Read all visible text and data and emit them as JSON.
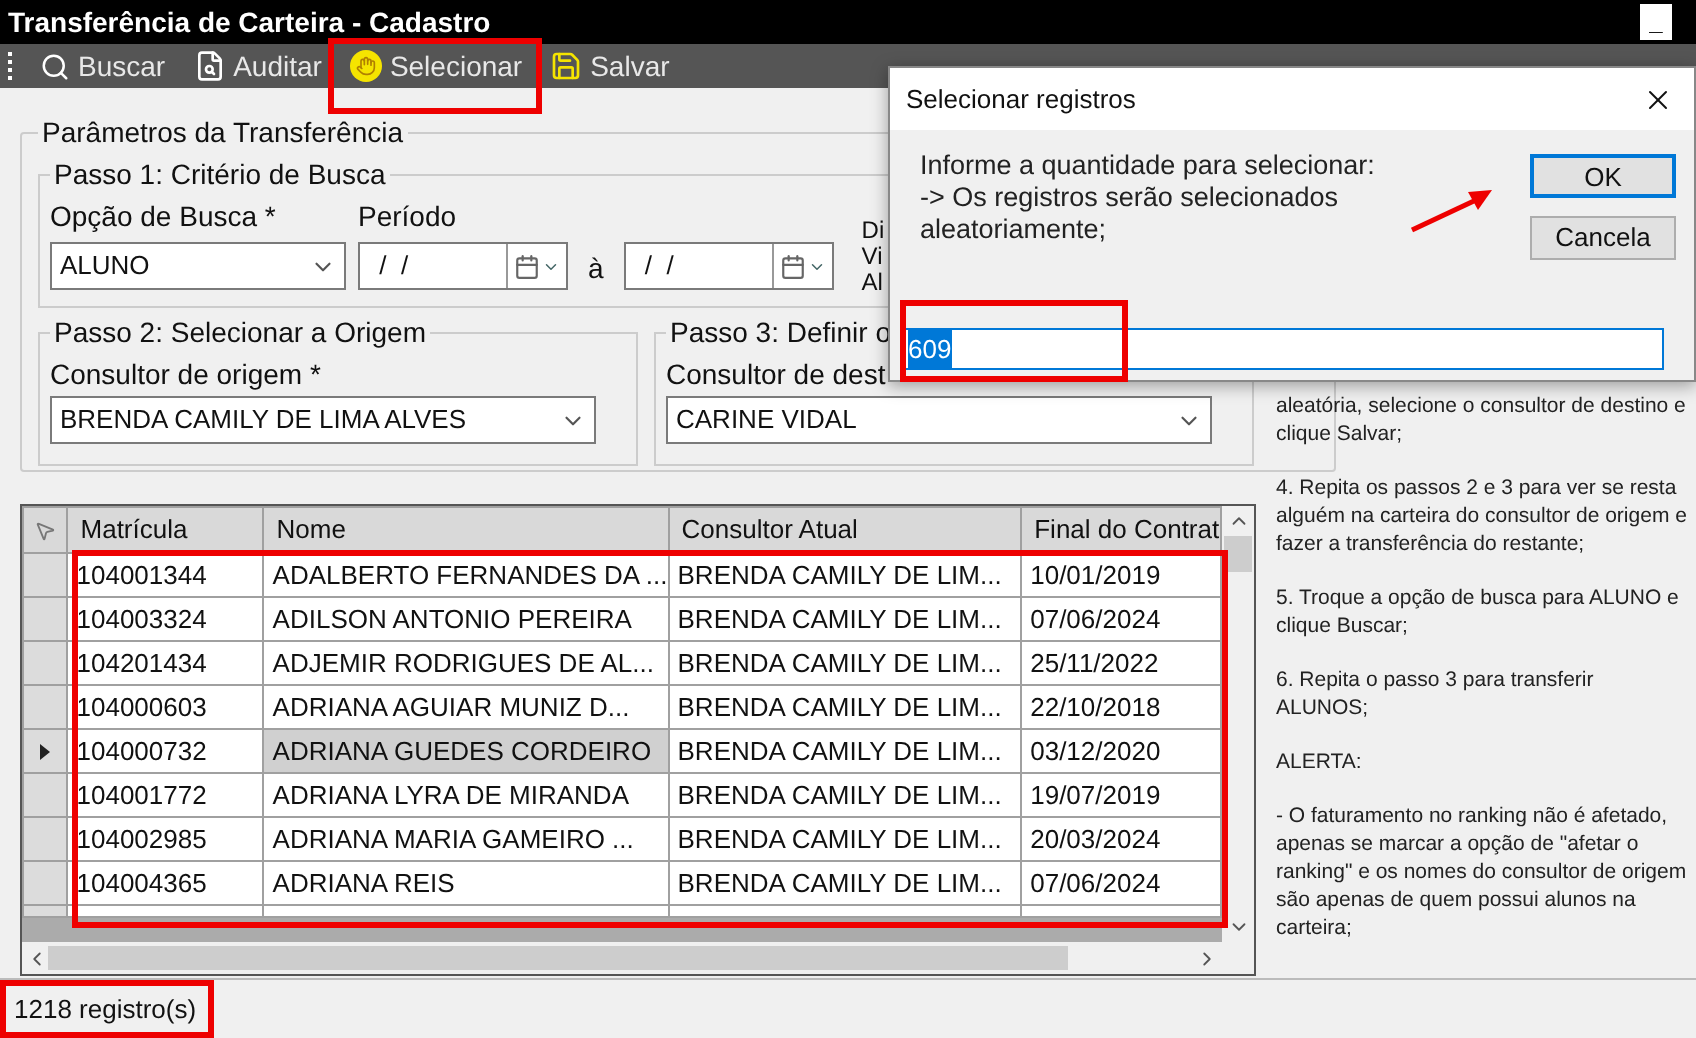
{
  "window": {
    "title": "Transferência de Carteira - Cadastro",
    "minimize": "_"
  },
  "toolbar": [
    {
      "kind": "search",
      "label": "Buscar"
    },
    {
      "kind": "audit",
      "label": "Auditar"
    },
    {
      "kind": "select",
      "label": "Selecionar"
    },
    {
      "kind": "save",
      "label": "Salvar"
    }
  ],
  "parameters": {
    "title": "Parâmetros da Transferência",
    "step1": {
      "title": "Passo 1: Critério de Busca",
      "search_option_label": "Opção de Busca *",
      "search_option_value": "ALUNO",
      "period_label": "Período",
      "period_from": " /  /",
      "period_to": " /  /",
      "period_separator": "à",
      "cut_labels": [
        "Di",
        "Vi",
        "Al"
      ]
    },
    "step2": {
      "title": "Passo 2: Selecionar a Origem",
      "label": "Consultor de origem *",
      "value": "BRENDA CAMILY DE LIMA ALVES"
    },
    "step3": {
      "title": "Passo 3: Definir o",
      "label": "Consultor de dest",
      "value": "CARINE VIDAL"
    }
  },
  "help_text": [
    "aleatória, selecione o consultor de destino e clique Salvar;",
    "4. Repita os passos 2 e 3 para ver se resta alguém na carteira do consultor de origem e fazer a transferência do restante;",
    "5. Troque a opção de busca para ALUNO e clique Buscar;",
    "6. Repita o passo 3 para transferir ALUNOS;",
    "ALERTA:",
    "- O faturamento no ranking não é afetado, apenas se marcar a opção de \"afetar o ranking\" e os nomes do consultor de origem são apenas de quem possui alunos na carteira;"
  ],
  "table": {
    "columns": [
      "Matrícula",
      "Nome",
      "Consultor Atual",
      "Final do Contrat"
    ],
    "rows": [
      {
        "cells": [
          "104001344",
          "ADALBERTO FERNANDES DA ...",
          "BRENDA CAMILY DE LIM...",
          "10/01/2019"
        ],
        "selected": false
      },
      {
        "cells": [
          "104003324",
          "ADILSON ANTONIO PEREIRA",
          "BRENDA CAMILY DE LIM...",
          "07/06/2024"
        ],
        "selected": false
      },
      {
        "cells": [
          "104201434",
          "ADJEMIR RODRIGUES DE AL...",
          "BRENDA CAMILY DE LIM...",
          "25/11/2022"
        ],
        "selected": false
      },
      {
        "cells": [
          "104000603",
          "ADRIANA AGUIAR MUNIZ D...",
          "BRENDA CAMILY DE LIM...",
          "22/10/2018"
        ],
        "selected": false
      },
      {
        "cells": [
          "104000732",
          "ADRIANA GUEDES CORDEIRO",
          "BRENDA CAMILY DE LIM...",
          "03/12/2020"
        ],
        "selected": true
      },
      {
        "cells": [
          "104001772",
          "ADRIANA LYRA DE MIRANDA",
          "BRENDA CAMILY DE LIM...",
          "19/07/2019"
        ],
        "selected": false
      },
      {
        "cells": [
          "104002985",
          "ADRIANA MARIA GAMEIRO ...",
          "BRENDA CAMILY DE LIM...",
          "20/03/2024"
        ],
        "selected": false
      },
      {
        "cells": [
          "104004365",
          "ADRIANA REIS",
          "BRENDA CAMILY DE LIM...",
          "07/06/2024"
        ],
        "selected": false
      }
    ]
  },
  "status_bar": {
    "count": "1218 registro(s)"
  },
  "dialog": {
    "title": "Selecionar registros",
    "message": [
      "Informe a quantidade para selecionar:",
      "-> Os registros serão selecionados",
      "aleatoriamente;"
    ],
    "value": "609",
    "buttons": [
      {
        "label": "OK",
        "default": true
      },
      {
        "label": "Cancela",
        "default": false
      }
    ]
  }
}
